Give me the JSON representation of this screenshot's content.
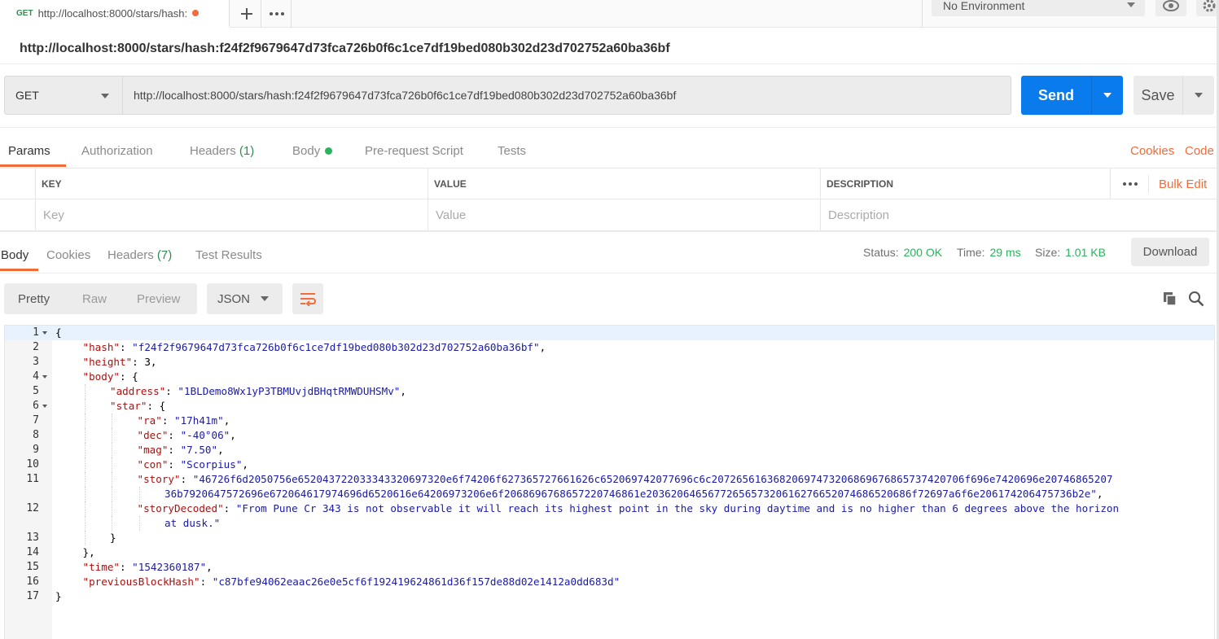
{
  "tab": {
    "method": "GET",
    "title": "http://localhost:8000/stars/hash:"
  },
  "environment": {
    "selected": "No Environment"
  },
  "request": {
    "name": "http://localhost:8000/stars/hash:f24f2f9679647d73fca726b0f6c1ce7df19bed080b302d23d702752a60ba36bf",
    "method": "GET",
    "url": "http://localhost:8000/stars/hash:f24f2f9679647d73fca726b0f6c1ce7df19bed080b302d23d702752a60ba36bf",
    "send_label": "Send",
    "save_label": "Save"
  },
  "request_tabs": {
    "params": "Params",
    "authorization": "Authorization",
    "headers": "Headers",
    "headers_count": "(1)",
    "body": "Body",
    "prerequest": "Pre-request Script",
    "tests": "Tests",
    "cookies": "Cookies",
    "code": "Code"
  },
  "params_table": {
    "key_header": "KEY",
    "value_header": "VALUE",
    "description_header": "DESCRIPTION",
    "bulk_edit": "Bulk Edit",
    "key_placeholder": "Key",
    "value_placeholder": "Value",
    "description_placeholder": "Description"
  },
  "response_tabs": {
    "body": "Body",
    "cookies": "Cookies",
    "headers": "Headers",
    "headers_count": "(7)",
    "test_results": "Test Results"
  },
  "response_status": {
    "status_label": "Status:",
    "status_value": "200 OK",
    "time_label": "Time:",
    "time_value": "29 ms",
    "size_label": "Size:",
    "size_value": "1.01 KB",
    "download_label": "Download"
  },
  "body_toolbar": {
    "pretty": "Pretty",
    "raw": "Raw",
    "preview": "Preview",
    "format": "JSON"
  },
  "code_lines": [
    {
      "n": "1",
      "fold": true,
      "indent": 0,
      "parts": [
        [
          "p",
          "{"
        ]
      ]
    },
    {
      "n": "2",
      "indent": 1,
      "parts": [
        [
          "k",
          "\"hash\""
        ],
        [
          "p",
          ": "
        ],
        [
          "s",
          "\"f24f2f9679647d73fca726b0f6c1ce7df19bed080b302d23d702752a60ba36bf\""
        ],
        [
          "p",
          ","
        ]
      ]
    },
    {
      "n": "3",
      "indent": 1,
      "parts": [
        [
          "k",
          "\"height\""
        ],
        [
          "p",
          ": 3,"
        ]
      ]
    },
    {
      "n": "4",
      "fold": true,
      "indent": 1,
      "parts": [
        [
          "k",
          "\"body\""
        ],
        [
          "p",
          ": {"
        ]
      ]
    },
    {
      "n": "5",
      "indent": 2,
      "parts": [
        [
          "k",
          "\"address\""
        ],
        [
          "p",
          ": "
        ],
        [
          "s",
          "\"1BLDemo8Wx1yP3TBMUvjdBHqtRMWDUHSMv\""
        ],
        [
          "p",
          ","
        ]
      ]
    },
    {
      "n": "6",
      "fold": true,
      "indent": 2,
      "parts": [
        [
          "k",
          "\"star\""
        ],
        [
          "p",
          ": {"
        ]
      ]
    },
    {
      "n": "7",
      "indent": 3,
      "parts": [
        [
          "k",
          "\"ra\""
        ],
        [
          "p",
          ": "
        ],
        [
          "s",
          "\"17h41m\""
        ],
        [
          "p",
          ","
        ]
      ]
    },
    {
      "n": "8",
      "indent": 3,
      "parts": [
        [
          "k",
          "\"dec\""
        ],
        [
          "p",
          ": "
        ],
        [
          "s",
          "\"-40°06\""
        ],
        [
          "p",
          ","
        ]
      ]
    },
    {
      "n": "9",
      "indent": 3,
      "parts": [
        [
          "k",
          "\"mag\""
        ],
        [
          "p",
          ": "
        ],
        [
          "s",
          "\"7.50\""
        ],
        [
          "p",
          ","
        ]
      ]
    },
    {
      "n": "10",
      "indent": 3,
      "parts": [
        [
          "k",
          "\"con\""
        ],
        [
          "p",
          ": "
        ],
        [
          "s",
          "\"Scorpius\""
        ],
        [
          "p",
          ","
        ]
      ]
    },
    {
      "n": "11",
      "indent": 3,
      "parts": [
        [
          "k",
          "\"story\""
        ],
        [
          "p",
          ": "
        ],
        [
          "s",
          "\"46726f6d2050756e652043722033343320697320e6f74206f627365727661626c652069742077696c6c20726561636820697473206869676865737420706f696e7420696e20746865207"
        ]
      ]
    },
    {
      "n": "",
      "indent": 4,
      "parts": [
        [
          "s",
          "36b7920647572696e672064617974696d6520616e64206973206e6f2068696768657220746861e2036206465677265657320616276652074686520686f72697a6f6e206174206475736b2e\""
        ],
        [
          "p",
          ","
        ]
      ]
    },
    {
      "n": "12",
      "indent": 3,
      "parts": [
        [
          "k",
          "\"storyDecoded\""
        ],
        [
          "p",
          ": "
        ],
        [
          "s",
          "\"From Pune Cr 343 is not observable it will reach its highest point in the sky during daytime and is no higher than 6 degrees above the horizon"
        ]
      ]
    },
    {
      "n": "",
      "indent": 4,
      "parts": [
        [
          "s",
          "at dusk.\""
        ]
      ]
    },
    {
      "n": "13",
      "indent": 2,
      "parts": [
        [
          "p",
          "}"
        ]
      ]
    },
    {
      "n": "14",
      "indent": 1,
      "parts": [
        [
          "p",
          "},"
        ]
      ]
    },
    {
      "n": "15",
      "indent": 1,
      "parts": [
        [
          "k",
          "\"time\""
        ],
        [
          "p",
          ": "
        ],
        [
          "s",
          "\"1542360187\""
        ],
        [
          "p",
          ","
        ]
      ]
    },
    {
      "n": "16",
      "indent": 1,
      "parts": [
        [
          "k",
          "\"previousBlockHash\""
        ],
        [
          "p",
          ": "
        ],
        [
          "s",
          "\"c87bfe94062eaac26e0e5cf6f192419624861d36f157de88d02e1412a0dd683d\""
        ]
      ]
    },
    {
      "n": "17",
      "indent": 0,
      "parts": [
        [
          "p",
          "}"
        ]
      ]
    }
  ],
  "colors": {
    "accent": "#f26b3a",
    "send_button": "#097bed",
    "success": "#2ab35c",
    "json_key": "#aa1111",
    "json_string": "#1a1aa6"
  },
  "icons": [
    "plus-icon",
    "more-icon",
    "eye-icon",
    "gear-icon",
    "caret-down-icon",
    "wrap-lines-icon",
    "copy-icon",
    "search-icon",
    "dot-icon"
  ]
}
